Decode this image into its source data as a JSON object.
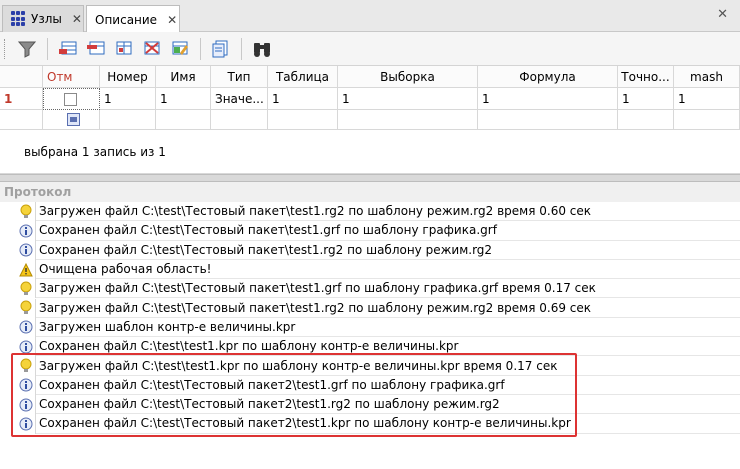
{
  "tabs": [
    {
      "label": "Узлы",
      "icon": "grid-icon",
      "active": false
    },
    {
      "label": "Описание",
      "icon": "",
      "active": true
    }
  ],
  "window": {
    "close_glyph": "✕"
  },
  "toolbar": {
    "buttons": [
      {
        "name": "filter-icon",
        "color": "#6c6c6c"
      },
      {
        "name": "add-row-icon",
        "color": "#2f6cc0"
      },
      {
        "name": "insert-row-icon",
        "color": "#2f6cc0"
      },
      {
        "name": "move-row-icon",
        "color": "#2f6cc0"
      },
      {
        "name": "delete-row-icon",
        "color": "#d23c3c"
      },
      {
        "name": "table-edit-icon",
        "color": "#2f6cc0"
      },
      {
        "name": "copy-icon",
        "color": "#2f6cc0"
      },
      {
        "name": "binoculars-icon",
        "color": "#333333"
      }
    ]
  },
  "table": {
    "columns": [
      "",
      "Отм",
      "Номер",
      "Имя",
      "Тип",
      "Таблица",
      "Выборка",
      "Формула",
      "Точно...",
      "mash"
    ],
    "rows": [
      {
        "num": "1",
        "checked": false,
        "cells": [
          "1",
          "1",
          "Значе...",
          "1",
          "1",
          "1",
          "1",
          "1"
        ]
      }
    ]
  },
  "status": {
    "text": "выбрана 1 запись из 1"
  },
  "protocol": {
    "title": "Протокол",
    "entries": [
      {
        "icon": "lightbulb-icon",
        "text": "Загружен файл C:\\test\\Тестовый пакет\\test1.rg2 по шаблону режим.rg2 время 0.60 сек"
      },
      {
        "icon": "info-icon",
        "text": "Сохранен файл C:\\test\\Тестовый пакет\\test1.grf по шаблону графика.grf"
      },
      {
        "icon": "info-icon",
        "text": "Сохранен файл C:\\test\\Тестовый пакет\\test1.rg2 по шаблону режим.rg2"
      },
      {
        "icon": "warning-icon",
        "text": "Очищена рабочая область!"
      },
      {
        "icon": "lightbulb-icon",
        "text": "Загружен файл C:\\test\\Тестовый пакет\\test1.grf по шаблону графика.grf время 0.17 сек"
      },
      {
        "icon": "lightbulb-icon",
        "text": "Загружен файл C:\\test\\Тестовый пакет\\test1.rg2 по шаблону режим.rg2 время 0.69 сек"
      },
      {
        "icon": "info-icon",
        "text": "Загружен шаблон контр-е величины.kpr"
      },
      {
        "icon": "info-icon",
        "text": "Сохранен файл C:\\test\\test1.kpr по шаблону контр-е величины.kpr"
      },
      {
        "icon": "lightbulb-icon",
        "text": "Загружен файл C:\\test\\test1.kpr по шаблону контр-е величины.kpr время 0.17 сек"
      },
      {
        "icon": "info-icon",
        "text": "Сохранен файл C:\\test\\Тестовый пакет2\\test1.grf по шаблону графика.grf"
      },
      {
        "icon": "info-icon",
        "text": "Сохранен файл C:\\test\\Тестовый пакет2\\test1.rg2 по шаблону режим.rg2"
      },
      {
        "icon": "info-icon",
        "text": "Сохранен файл C:\\test\\Тестовый пакет2\\test1.kpr по шаблону контр-е величины.kpr"
      }
    ]
  },
  "colors": {
    "highlight": "#dd3333",
    "row_marker": "#c0392b",
    "muted_header": "#a0a0a0"
  }
}
